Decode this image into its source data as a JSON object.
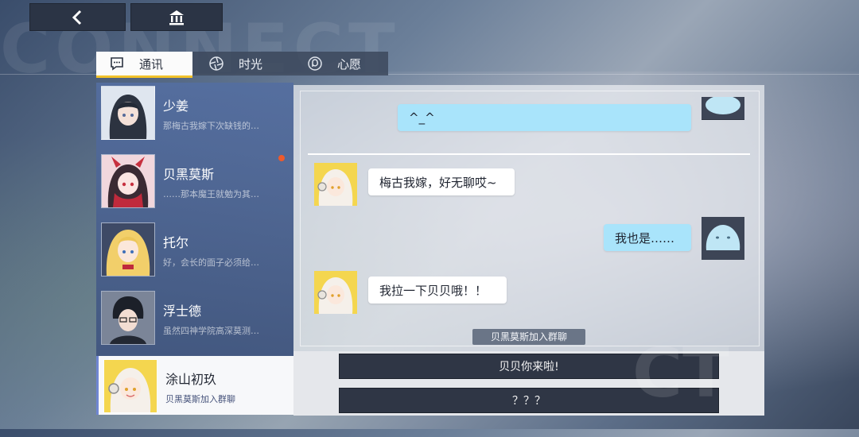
{
  "background": {
    "watermark_text": "CONNECT"
  },
  "nav": {
    "back_icon": "chevron-left-icon",
    "home_icon": "museum-icon"
  },
  "tabs": [
    {
      "label": "通讯",
      "icon": "chat-bubble-icon",
      "active": true
    },
    {
      "label": "时光",
      "icon": "aperture-icon",
      "active": false
    },
    {
      "label": "心愿",
      "icon": "spiral-icon",
      "active": false
    }
  ],
  "contacts": [
    {
      "name": "少姜",
      "preview": "那梅古我嫁下次缺钱的…",
      "unread": false
    },
    {
      "name": "贝黑莫斯",
      "preview": "……那本魔王就勉为其…",
      "unread": true
    },
    {
      "name": "托尔",
      "preview": "好，会长的面子必须给…",
      "unread": false
    },
    {
      "name": "浮士德",
      "preview": "虽然四神学院高深莫测…",
      "unread": false
    },
    {
      "name": "涂山初玖",
      "preview": "贝黑莫斯加入群聊",
      "unread": false,
      "active": true
    }
  ],
  "chat": {
    "messages": [
      {
        "side": "right",
        "text": "^_^"
      },
      {
        "side": "left",
        "text": "梅古我嫁，好无聊哎~"
      },
      {
        "side": "right",
        "text": "我也是……"
      },
      {
        "side": "left",
        "text": "我拉一下贝贝哦！！"
      }
    ],
    "system_notice": "贝黑莫斯加入群聊"
  },
  "replies": [
    {
      "label": "贝贝你来啦!"
    },
    {
      "label": "？？？"
    }
  ],
  "colors": {
    "accent": "#f2c229",
    "unread": "#ee5a2b",
    "bubble_self": "#a9e4fb",
    "bubble_other": "#ffffff"
  }
}
